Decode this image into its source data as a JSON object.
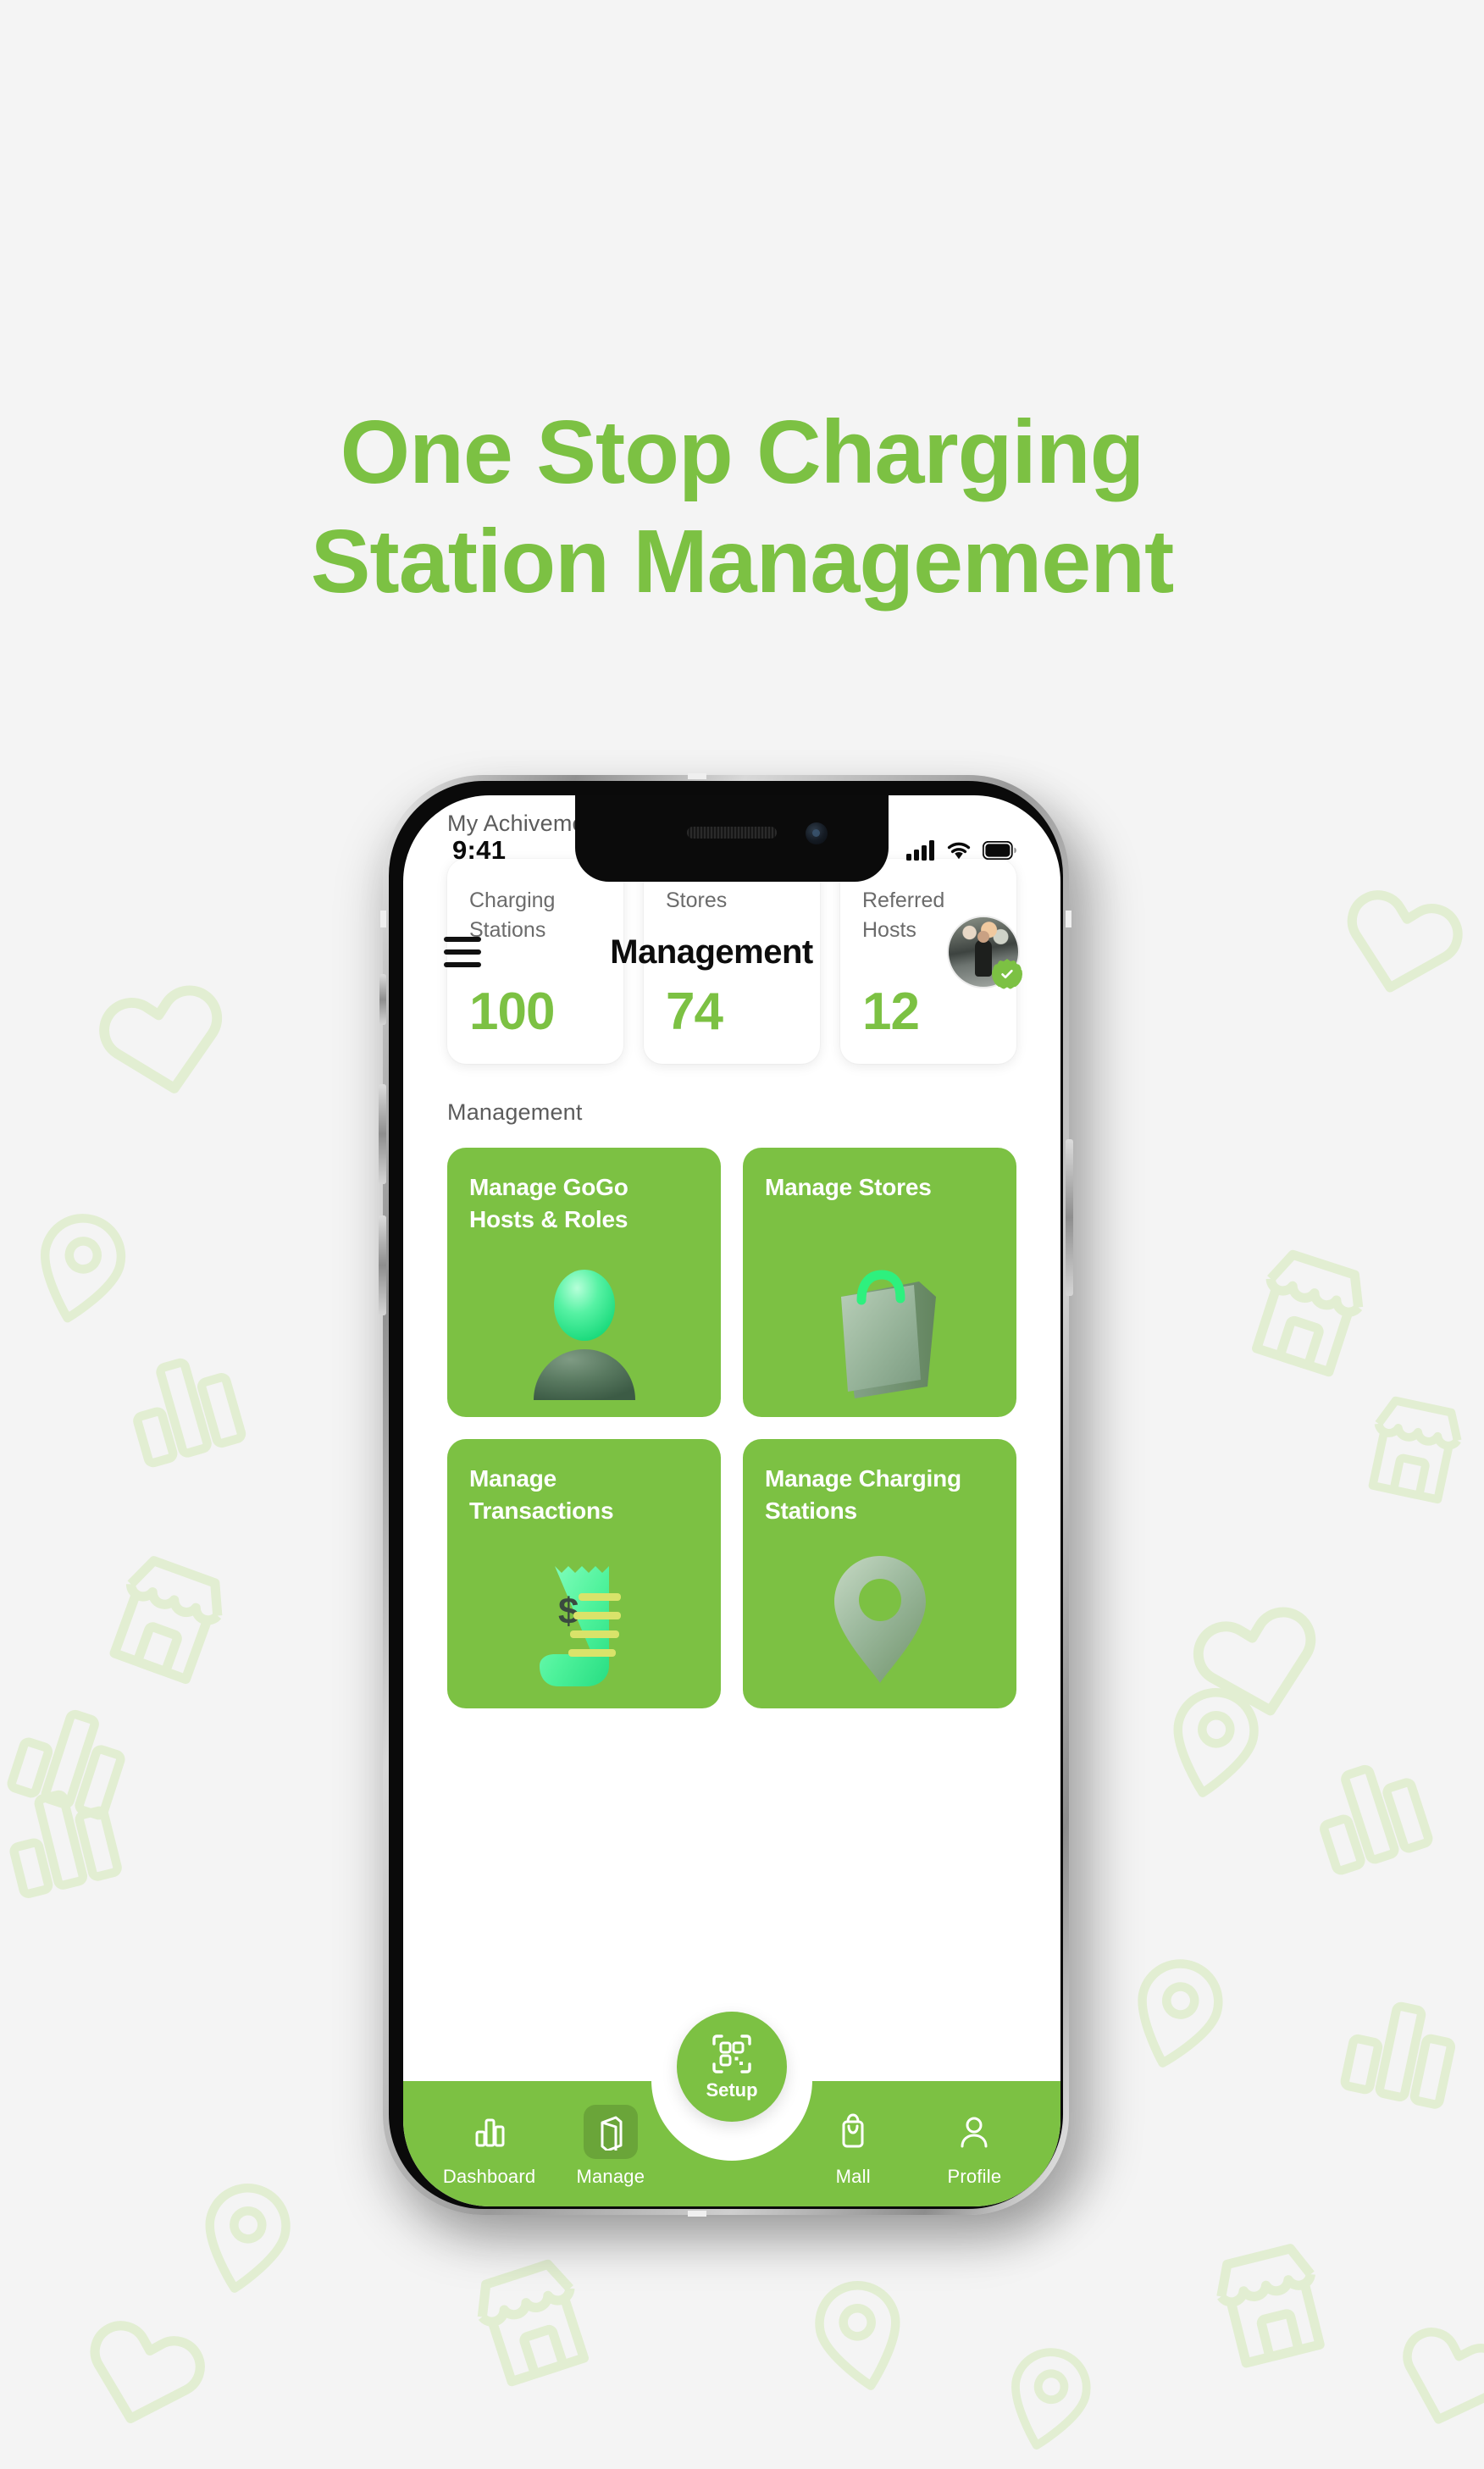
{
  "page": {
    "background_color": "#f4f4f4",
    "brand_green": "#7cc143",
    "watermark_color": "#e2eed2"
  },
  "headline": {
    "line1": "One Stop Charging",
    "line2": "Station Management",
    "color": "#7cc143"
  },
  "phone": {
    "status_bar": {
      "time": "9:41",
      "icons": [
        "cellular-signal-icon",
        "wifi-icon",
        "battery-icon"
      ]
    },
    "header": {
      "menu_icon": "hamburger-menu-icon",
      "title": "Management",
      "avatar_icon": "user-avatar",
      "verified_badge": "verified-check-icon",
      "badge_color": "#7cc143"
    },
    "achievements": {
      "section_label": "My Achivements",
      "cards": [
        {
          "label": "Charging Stations",
          "value": "100"
        },
        {
          "label": "Stores",
          "value": "74"
        },
        {
          "label": "Referred Hosts",
          "value": "12"
        }
      ],
      "value_color": "#7cc143"
    },
    "management": {
      "section_label": "Management",
      "cards": [
        {
          "title": "Manage GoGo Hosts & Roles",
          "icon": "person-3d-icon"
        },
        {
          "title": "Manage Stores",
          "icon": "shopping-bag-3d-icon"
        },
        {
          "title": "Manage Transactions",
          "icon": "receipt-3d-icon"
        },
        {
          "title": "Manage Charging Stations",
          "icon": "location-pin-3d-icon"
        }
      ],
      "card_color": "#7cc143"
    },
    "bottom_nav": {
      "fab": {
        "label": "Setup",
        "icon": "qr-code-icon"
      },
      "items": [
        {
          "label": "Dashboard",
          "icon": "bar-chart-icon",
          "active": false
        },
        {
          "label": "Manage",
          "icon": "box-3d-icon",
          "active": true
        },
        {
          "label": "Mall",
          "icon": "shopping-bag-icon",
          "active": false
        },
        {
          "label": "Profile",
          "icon": "person-icon",
          "active": false
        }
      ],
      "bar_color": "#7cc143"
    }
  }
}
